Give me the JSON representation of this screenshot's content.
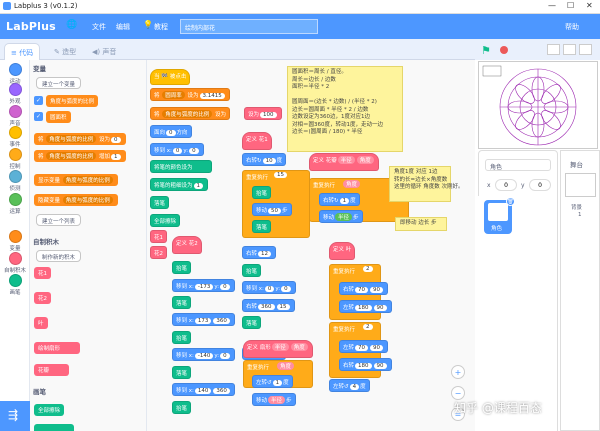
{
  "window": {
    "title": "Labplus 3 (v0.1.2)",
    "controls": [
      "—",
      "☐",
      "✕"
    ]
  },
  "menubar": {
    "logo": "LabPlus",
    "globe": "🌐",
    "file": "文件",
    "edit": "编辑",
    "tutorial": "教程",
    "project_name": "绘制内部花",
    "help": "帮助"
  },
  "tabs": {
    "code": "代码",
    "costume": "造型",
    "sound": "声音"
  },
  "categories": [
    {
      "label": "运动",
      "color": "#4c97ff"
    },
    {
      "label": "外观",
      "color": "#9966ff"
    },
    {
      "label": "声音",
      "color": "#cf63cf"
    },
    {
      "label": "事件",
      "color": "#ffbf00"
    },
    {
      "label": "控制",
      "color": "#ffab19"
    },
    {
      "label": "侦测",
      "color": "#5cb1d6"
    },
    {
      "label": "运算",
      "color": "#59c059"
    },
    {
      "label": "变量",
      "color": "#ff8c1a"
    },
    {
      "label": "自制积木",
      "color": "#ff6680"
    },
    {
      "label": "画笔",
      "color": "#0fbd8c"
    }
  ],
  "palette": {
    "variables_title": "变量",
    "make_variable": "建立一个变量",
    "var1": "角度与弧度的比例",
    "var2": "圆面积",
    "set_block": "将",
    "set_target": "角度与弧度的比例",
    "set_to": "设为",
    "set_val": "0",
    "change_block": "将",
    "change_target": "角度与弧度的比例",
    "change_by": "增加",
    "change_val": "1",
    "show_var": "显示变量",
    "show_target": "角度与弧度的比例",
    "hide_var": "隐藏变量",
    "hide_target": "角度与弧度的比例",
    "make_list": "建立一个列表",
    "myblocks_title": "自制积木",
    "make_block": "制作新的积木",
    "custom1": "花1",
    "custom2": "花2",
    "custom3": "叶",
    "custom4": "绘制扇形",
    "custom5": "花瓣",
    "pen_title": "画笔",
    "pen_erase": "全部擦除"
  },
  "workspace": {
    "hat_flag": "当 🏁 被点击",
    "s1_a": "将",
    "s1_b": "圆周率",
    "s1_c": "设为",
    "s1_v": "3.1415",
    "s2_a": "将",
    "s2_b": "角度与弧度的比例",
    "s2_c": "设为",
    "s3_a": "面向",
    "s3_v": "0",
    "s3_b": "方向",
    "s4_a": "移到 x:",
    "s4_v": "0",
    "s4_b": "y:",
    "s4_v2": "0",
    "s5_a": "将笔的颜色设为",
    "s6_a": "将笔的粗细设为",
    "s6_v": "1",
    "s7": "落笔",
    "s8": "全部擦除",
    "def_flower1": "定义 花1",
    "def_flower2": "定义 花2",
    "call_flower1": "花1",
    "call_flower2": "花2",
    "pen_down": "抬笔",
    "goto_x": "移到 x:",
    "goto_y": "y:",
    "x1": "-173",
    "y1": "0",
    "x2": "173",
    "y2": "360",
    "x3": "-140",
    "y3": "0",
    "x4": "140",
    "y4": "360",
    "turn_right": "右转",
    "turn_left": "左转",
    "deg": "度",
    "step": "步",
    "repeat": "重复执行",
    "times": "次",
    "move": "移动",
    "def_leaf": "定义 叶",
    "def_arc": "定义 扇形",
    "arc_radius": "半径",
    "arc_angle": "角度",
    "draw_arc": "绘制扇形",
    "def_petal": "定义 花瓣",
    "petal_radius": "半径",
    "petal_angle": "角度",
    "v_100": "100",
    "v_1": "1",
    "v_15": "15",
    "v_50": "50",
    "v_12": "12",
    "v_2": "2",
    "v_360": "360",
    "v_10": "10",
    "v_70": "70",
    "v_90": "90",
    "v_180": "180",
    "v_4": "4",
    "repeat_ang": "角度",
    "note1": "圆面积＝周长 / 直径。\n周长＝边长 / 边数\n面积＝半径 * 2\n\n圆周面＝(边长 * 边数) / (半径 * 2)\n边长＝圆周面 * 半径 * 2 / 边数\n边数设定为360边，1度对应1边\n对相＝圆360度，转动1度，走动一边\n边长＝(圆周面 / 180) * 半径",
    "note2": "角度1度 对应 1边\n转的长=边长×角度数\n这里的循环 角度数 次刚好。",
    "note3": "即移动 边长 步"
  },
  "sprite": {
    "name_label": "角色",
    "x": "0",
    "y": "0",
    "x_label": "x",
    "y_label": "y",
    "sprite_name": "角色"
  },
  "stage": {
    "label": "舞台",
    "backdrop_label": "背景",
    "backdrop_count": "1"
  },
  "watermark": "知乎 @课程百态"
}
